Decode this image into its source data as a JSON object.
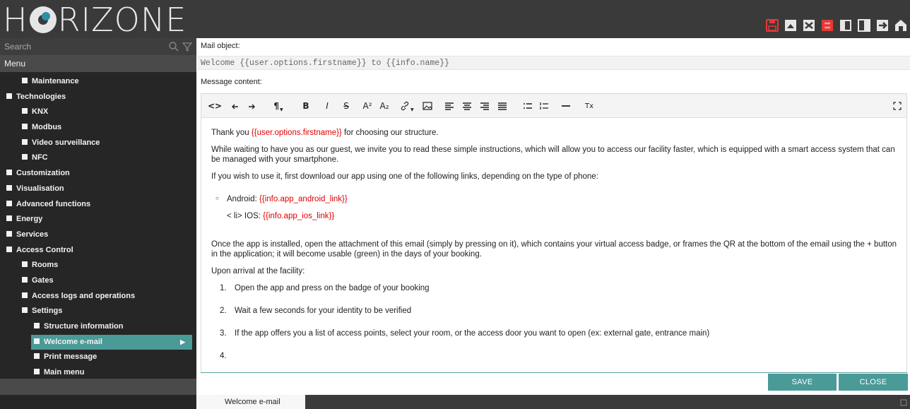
{
  "app": {
    "logo_text_start": "H",
    "logo_text_end": "RIZONE",
    "brand_color": "#4a9a97",
    "alert_color": "#e53935"
  },
  "top_icons": [
    "save-icon",
    "cloud-icon",
    "tools-icon",
    "alert-icon",
    "panel-left-icon",
    "panel-right-icon",
    "forward-icon",
    "home-icon"
  ],
  "search": {
    "placeholder": "Search"
  },
  "menu": {
    "title": "Menu",
    "items": [
      {
        "label": "Maintenance",
        "level": 1
      },
      {
        "label": "Technologies",
        "level": 0
      },
      {
        "label": "KNX",
        "level": 1
      },
      {
        "label": "Modbus",
        "level": 1
      },
      {
        "label": "Video surveillance",
        "level": 1
      },
      {
        "label": "NFC",
        "level": 1
      },
      {
        "label": "Customization",
        "level": 0
      },
      {
        "label": "Visualisation",
        "level": 0
      },
      {
        "label": "Advanced functions",
        "level": 0
      },
      {
        "label": "Energy",
        "level": 0
      },
      {
        "label": "Services",
        "level": 0
      },
      {
        "label": "Access Control",
        "level": 0
      },
      {
        "label": "Rooms",
        "level": 1
      },
      {
        "label": "Gates",
        "level": 1
      },
      {
        "label": "Access logs and operations",
        "level": 1
      },
      {
        "label": "Settings",
        "level": 1
      },
      {
        "label": "Structure information",
        "level": 2
      },
      {
        "label": "Welcome e-mail",
        "level": 2,
        "active": true
      },
      {
        "label": "Print message",
        "level": 2
      },
      {
        "label": "Main menu",
        "level": 2
      }
    ]
  },
  "mail": {
    "object_label": "Mail object:",
    "object_value": "Welcome {{user.options.firstname}} to {{info.name}}",
    "content_label": "Message content:"
  },
  "toolbar": {
    "source": "<>",
    "bold": "B",
    "italic": "I",
    "strike": "S",
    "superscript": "A²",
    "subscript": "A₂",
    "clear_format": "Tx"
  },
  "content": {
    "p1_before": "Thank you ",
    "p1_var": "{{user.options.firstname}}",
    "p1_after": " for choosing our structure.",
    "p2": "While waiting to have you as our guest, we invite you to read these simple instructions, which will allow you to access our facility faster, which is equipped with a smart access system that can be managed with your smartphone.",
    "p3": "If you wish to use it, first download our app using one of the following links, depending on the type of phone:",
    "android_label": "Android: ",
    "android_var": "{{info.app_android_link}}",
    "ios_label": "< li> IOS: ",
    "ios_var": "{{info.app_ios_link}}",
    "p4": "Once the app is installed, open the attachment of this email (simply by pressing on it), which contains your virtual access badge, or frames the QR at the bottom of the email using the + button in the application; it will become usable (green) in the days of your booking.",
    "p5": "Upon arrival at the facility:",
    "steps": [
      {
        "num": "1.",
        "text": "Open the app and press on the badge of your booking"
      },
      {
        "num": "2.",
        "text": "Wait a few seconds for your identity to be verified"
      },
      {
        "num": "3.",
        "text": "If the app offers you a list of access points, select your room, or the access door you want to open (ex: external gate, entrance main)"
      },
      {
        "num": "4.",
        "text": ""
      }
    ]
  },
  "buttons": {
    "save": "SAVE",
    "close": "CLOSE"
  },
  "tabs": [
    {
      "label": "Welcome e-mail"
    }
  ]
}
